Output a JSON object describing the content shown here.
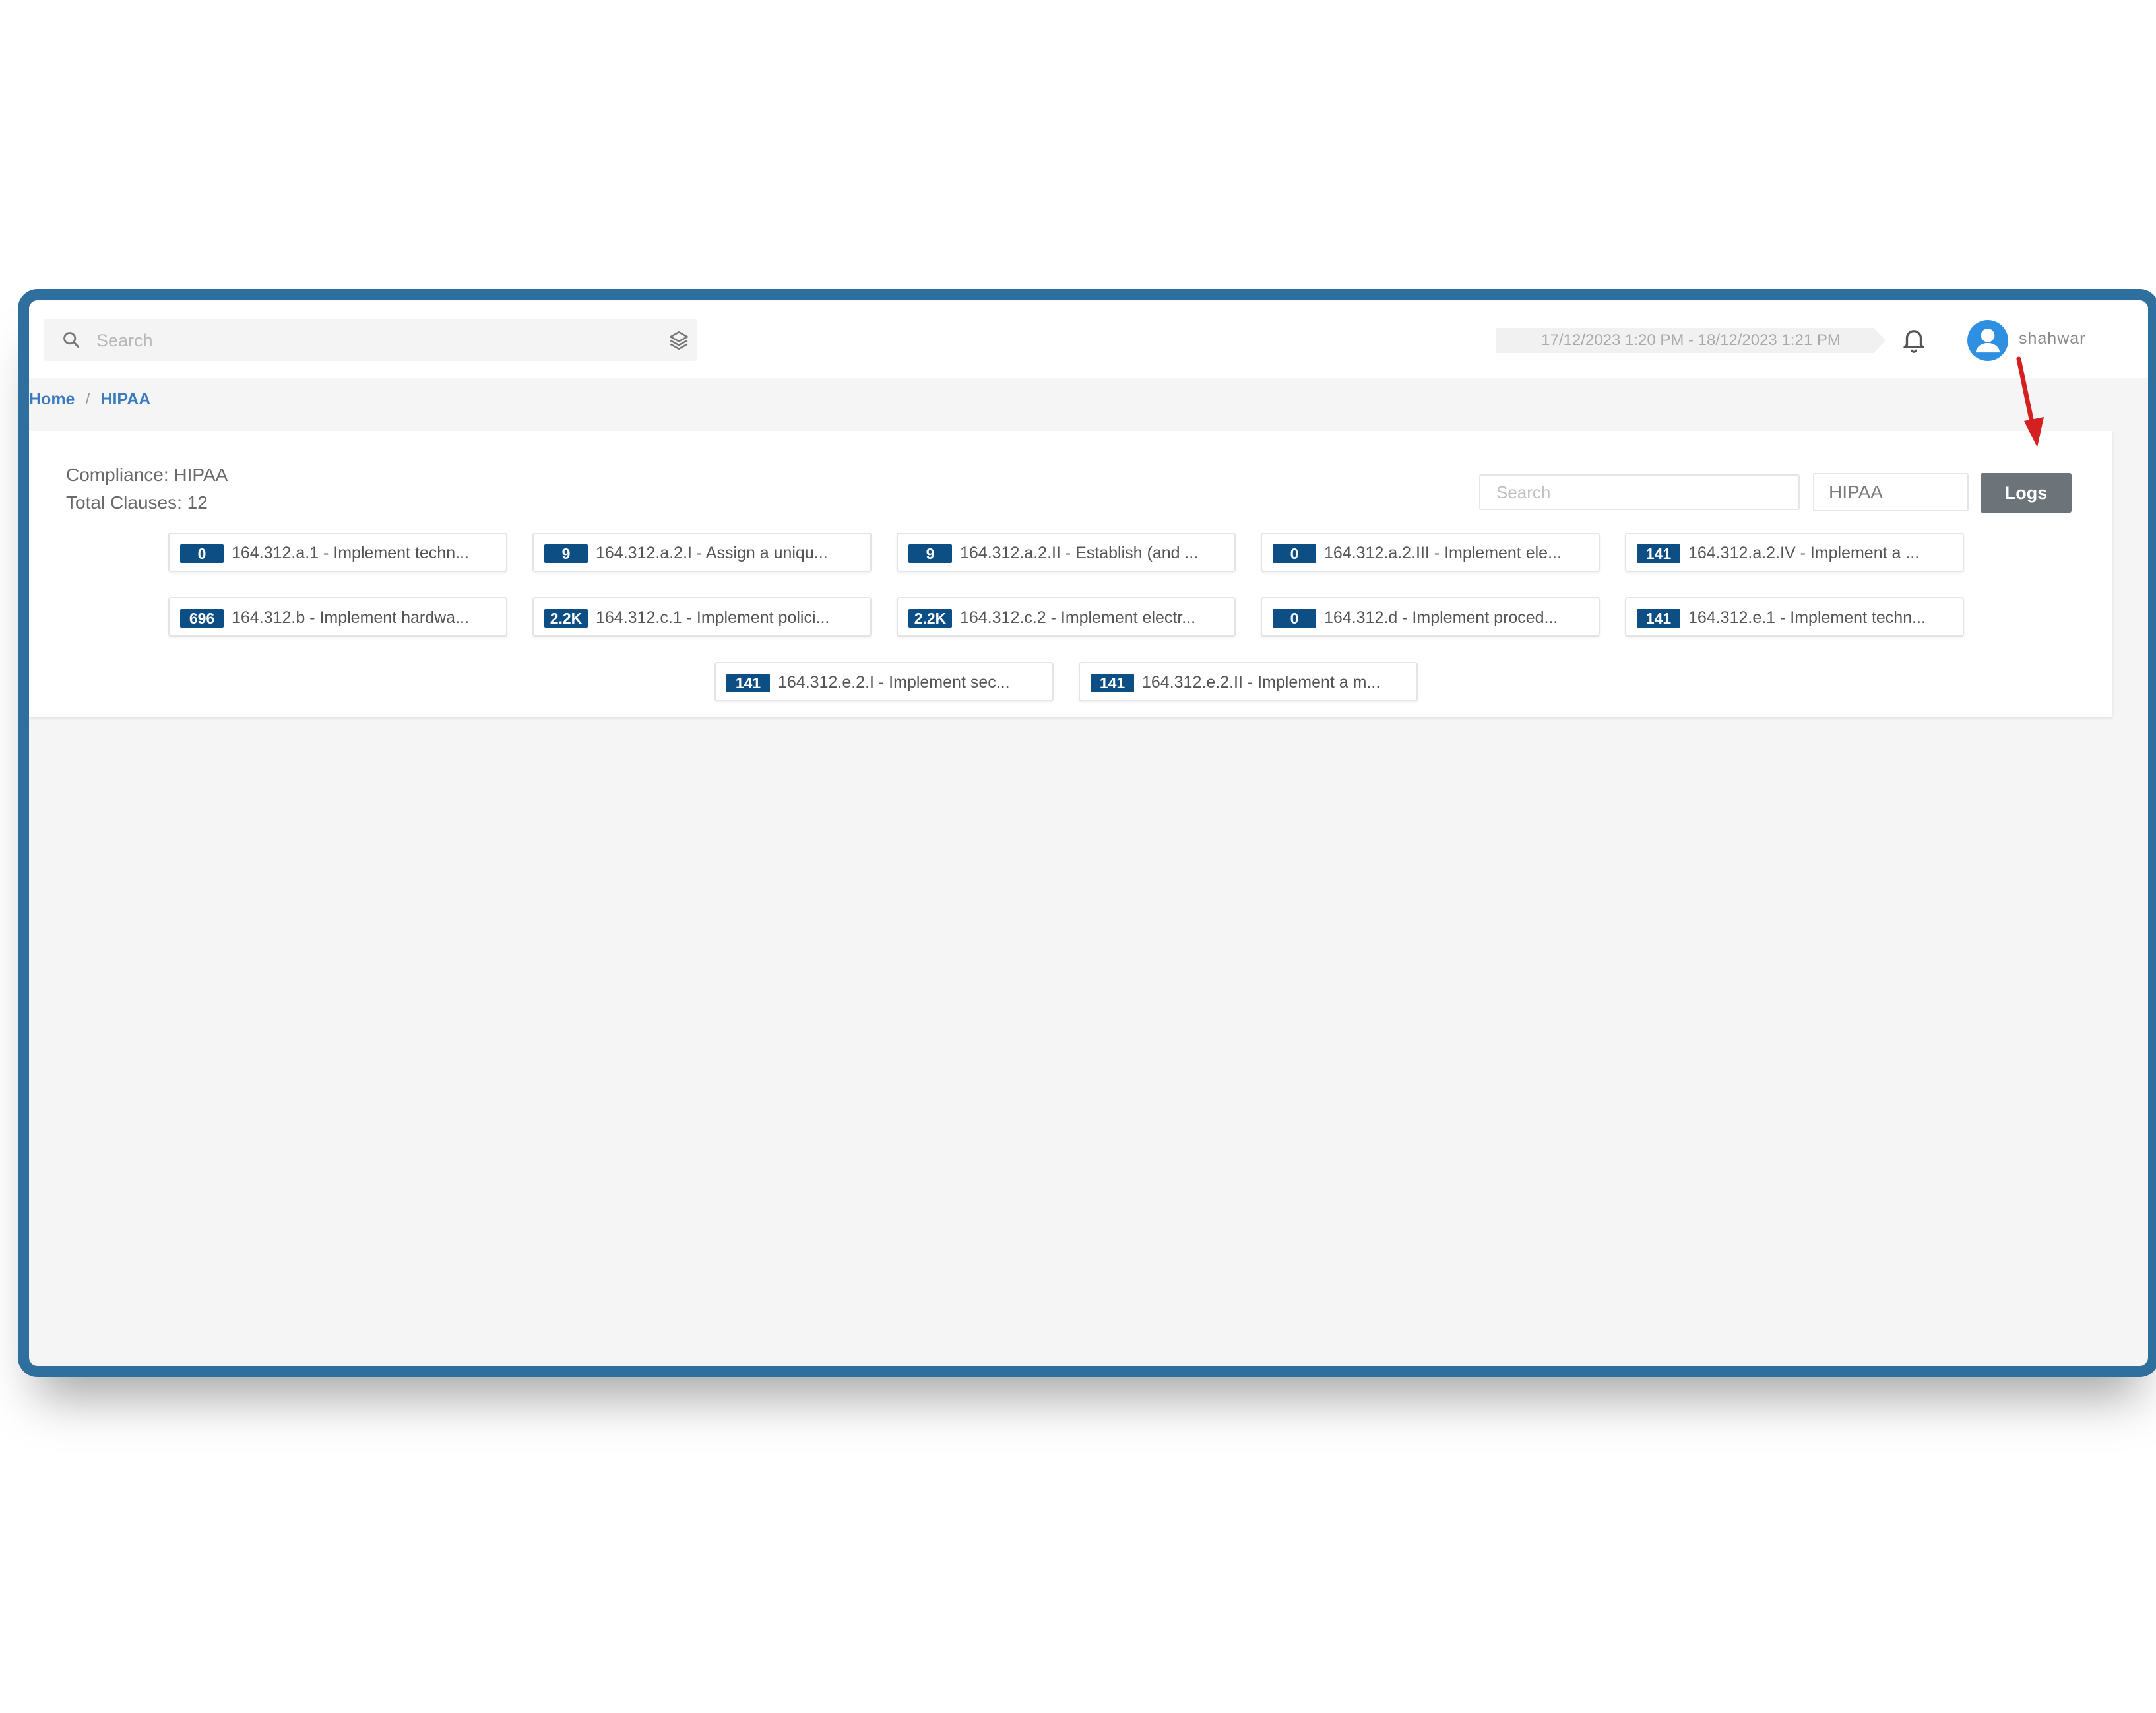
{
  "topbar": {
    "search_placeholder": "Search",
    "date_range": "17/12/2023 1:20 PM - 18/12/2023 1:21 PM",
    "user_name": "shahwar"
  },
  "breadcrumb": {
    "home": "Home",
    "separator": "/",
    "current": "HIPAA"
  },
  "panel": {
    "compliance": "Compliance: HIPAA",
    "total_clauses": "Total Clauses: 12",
    "search_placeholder": "Search",
    "compliance_value": "HIPAA",
    "logs_label": "Logs"
  },
  "clauses": [
    {
      "count": "0",
      "label": "164.312.a.1 - Implement techn..."
    },
    {
      "count": "9",
      "label": "164.312.a.2.I - Assign a uniqu..."
    },
    {
      "count": "9",
      "label": "164.312.a.2.II - Establish (and ..."
    },
    {
      "count": "0",
      "label": "164.312.a.2.III - Implement ele..."
    },
    {
      "count": "141",
      "label": "164.312.a.2.IV - Implement a ..."
    },
    {
      "count": "696",
      "label": "164.312.b - Implement hardwa..."
    },
    {
      "count": "2.2K",
      "label": "164.312.c.1 - Implement polici..."
    },
    {
      "count": "2.2K",
      "label": "164.312.c.2 - Implement electr..."
    },
    {
      "count": "0",
      "label": "164.312.d - Implement proced..."
    },
    {
      "count": "141",
      "label": "164.312.e.1 - Implement techn..."
    },
    {
      "count": "141",
      "label": "164.312.e.2.I - Implement sec..."
    },
    {
      "count": "141",
      "label": "164.312.e.2.II - Implement a m..."
    }
  ],
  "colors": {
    "frame_border": "#2e6f9e",
    "badge": "#0d4f85",
    "link": "#3a7bbf",
    "logs_button": "#6d7479",
    "avatar": "#2f8fe0",
    "annotation_arrow": "#d42020"
  },
  "icons": [
    "search-icon",
    "layers-icon",
    "bell-icon",
    "user-icon",
    "annotation-arrow"
  ]
}
